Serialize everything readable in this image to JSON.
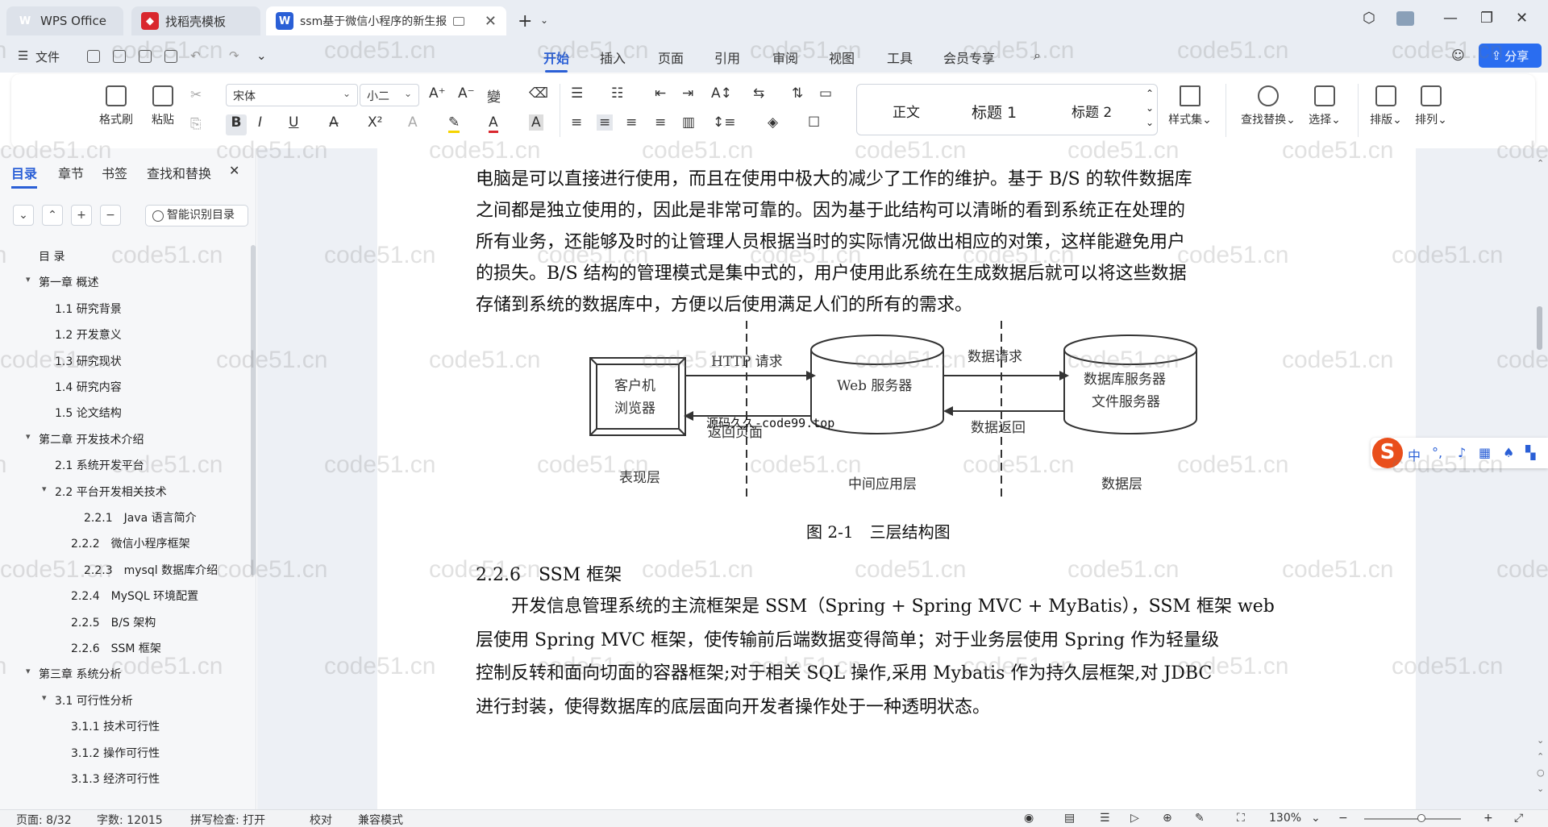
{
  "titlebar": {
    "tabs": [
      {
        "label": "WPS Office"
      },
      {
        "label": "找稻壳模板"
      },
      {
        "label": "ssm基于微信小程序的新生报"
      }
    ]
  },
  "menu": {
    "file": "文件",
    "tabs": [
      "开始",
      "插入",
      "页面",
      "引用",
      "审阅",
      "视图",
      "工具",
      "会员专享"
    ],
    "active_tab": "开始",
    "share": "分享"
  },
  "ribbon": {
    "format_painter": "格式刷",
    "paste": "粘贴",
    "font": "宋体",
    "font_size": "小二",
    "styles": [
      "正文",
      "标题 1",
      "标题 2"
    ],
    "style_set": "样式集",
    "find_replace": "查找替换",
    "select": "选择",
    "layout": "排版",
    "arrange": "排列"
  },
  "sidebar": {
    "tabs": [
      "目录",
      "章节",
      "书签",
      "查找和替换"
    ],
    "active_tab": "目录",
    "smart_toc": "智能识别目录",
    "toc": [
      {
        "label": "目 录",
        "level": 0,
        "caret": ""
      },
      {
        "label": "第一章 概述",
        "level": 0,
        "caret": "▾"
      },
      {
        "label": "1.1 研究背景",
        "level": 1,
        "caret": ""
      },
      {
        "label": "1.2 开发意义",
        "level": 1,
        "caret": ""
      },
      {
        "label": "1.3 研究现状",
        "level": 1,
        "caret": ""
      },
      {
        "label": "1.4 研究内容",
        "level": 1,
        "caret": ""
      },
      {
        "label": "1.5 论文结构",
        "level": 1,
        "caret": ""
      },
      {
        "label": "第二章 开发技术介绍",
        "level": 0,
        "caret": "▾"
      },
      {
        "label": "2.1 系统开发平台",
        "level": 1,
        "caret": ""
      },
      {
        "label": "2.2 平台开发相关技术",
        "level": 1,
        "caret": "▾"
      },
      {
        "label": "2.2.1　Java 语言简介",
        "level": 3,
        "caret": ""
      },
      {
        "label": "2.2.2　微信小程序框架",
        "level": 2,
        "caret": ""
      },
      {
        "label": "2.2.3　mysql 数据库介绍",
        "level": 3,
        "caret": ""
      },
      {
        "label": "2.2.4　MySQL 环境配置",
        "level": 2,
        "caret": ""
      },
      {
        "label": "2.2.5　B/S 架构",
        "level": 2,
        "caret": ""
      },
      {
        "label": "2.2.6　SSM 框架",
        "level": 2,
        "caret": ""
      },
      {
        "label": "第三章 系统分析",
        "level": 0,
        "caret": "▾"
      },
      {
        "label": "3.1 可行性分析",
        "level": 1,
        "caret": "▾"
      },
      {
        "label": "3.1.1 技术可行性",
        "level": 2,
        "caret": ""
      },
      {
        "label": "3.1.2 操作可行性",
        "level": 2,
        "caret": ""
      },
      {
        "label": "3.1.3 经济可行性",
        "level": 2,
        "caret": ""
      }
    ]
  },
  "document": {
    "lines_top": [
      "电脑是可以直接进行使用，而且在使用中极大的减少了工作的维护。基于 B/S 的软件数据库",
      "之间都是独立使用的，因此是非常可靠的。因为基于此结构可以清晰的看到系统正在处理的",
      "所有业务，还能够及时的让管理人员根据当时的实际情况做出相应的对策，这样能避免用户",
      "的损失。B/S 结构的管理模式是集中式的，用户使用此系统在生成数据后就可以将这些数据",
      "存储到系统的数据库中，方便以后使用满足人们的所有的需求。"
    ],
    "diagram": {
      "client": [
        "客户机",
        "浏览器"
      ],
      "web": "Web 服务器",
      "db": [
        "数据库服务器",
        "文件服务器"
      ],
      "http_request": "HTTP 请求",
      "return_page": "返回页面",
      "data_request": "数据请求",
      "data_return": "数据返回",
      "layer_presentation": "表现层",
      "layer_middle": "中间应用层",
      "layer_data": "数据层",
      "overlay": "源码久久-code99.top"
    },
    "caption": "图 2-1　三层结构图",
    "heading": "2.2.6　SSM 框架",
    "lines_bottom": [
      "　　开发信息管理系统的主流框架是 SSM（Spring + Spring MVC + MyBatis），SSM 框架 web",
      "层使用 Spring MVC 框架，使传输前后端数据变得简单；对于业务层使用 Spring 作为轻量级",
      "控制反转和面向切面的容器框架;对于相关 SQL 操作,采用 Mybatis 作为持久层框架,对 JDBC",
      "进行封装，使得数据库的底层面向开发者操作处于一种透明状态。"
    ]
  },
  "ime": {
    "logo": "S",
    "mode": "中"
  },
  "status": {
    "page": "页面: 8/32",
    "words": "字数: 12015",
    "spell": "拼写检查: 打开",
    "proof": "校对",
    "compat": "兼容模式",
    "zoom": "130%"
  },
  "watermark": "code51.cn",
  "colors": {
    "accent": "#2a5fd6",
    "share": "#2a6df0"
  }
}
